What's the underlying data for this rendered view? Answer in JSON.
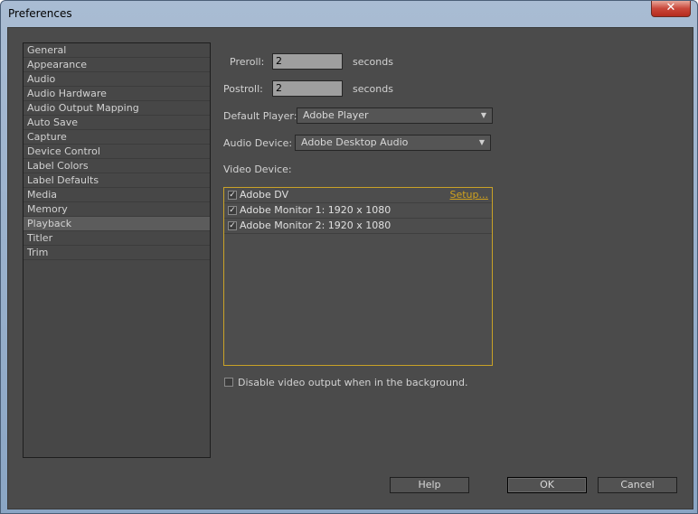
{
  "window": {
    "title": "Preferences",
    "close_glyph": "✕"
  },
  "sidebar": {
    "items": [
      {
        "label": "General"
      },
      {
        "label": "Appearance"
      },
      {
        "label": "Audio"
      },
      {
        "label": "Audio Hardware"
      },
      {
        "label": "Audio Output Mapping"
      },
      {
        "label": "Auto Save"
      },
      {
        "label": "Capture"
      },
      {
        "label": "Device Control"
      },
      {
        "label": "Label Colors"
      },
      {
        "label": "Label Defaults"
      },
      {
        "label": "Media"
      },
      {
        "label": "Memory"
      },
      {
        "label": "Playback",
        "selected": true
      },
      {
        "label": "Titler"
      },
      {
        "label": "Trim"
      }
    ]
  },
  "playback": {
    "preroll": {
      "label": "Preroll:",
      "value": "2",
      "unit": "seconds"
    },
    "postroll": {
      "label": "Postroll:",
      "value": "2",
      "unit": "seconds"
    },
    "default_player": {
      "label": "Default Player:",
      "value": "Adobe Player"
    },
    "audio_device": {
      "label": "Audio Device:",
      "value": "Adobe Desktop Audio"
    },
    "video_device": {
      "label": "Video Device:",
      "devices": [
        {
          "name": "Adobe DV",
          "checked": true,
          "setup_label": "Setup..."
        },
        {
          "name": "Adobe Monitor 1: 1920 x 1080",
          "checked": true
        },
        {
          "name": "Adobe Monitor 2: 1920 x 1080",
          "checked": true
        }
      ]
    },
    "disable_bg": {
      "label": "Disable video output when in the background.",
      "checked": false
    }
  },
  "buttons": {
    "help": "Help",
    "ok": "OK",
    "cancel": "Cancel"
  },
  "icons": {
    "check": "✓",
    "dropdown_arrow": "▼"
  },
  "colors": {
    "accent_border": "#c9a227",
    "link": "#d0a21d",
    "panel_bg": "#4b4b4b"
  }
}
